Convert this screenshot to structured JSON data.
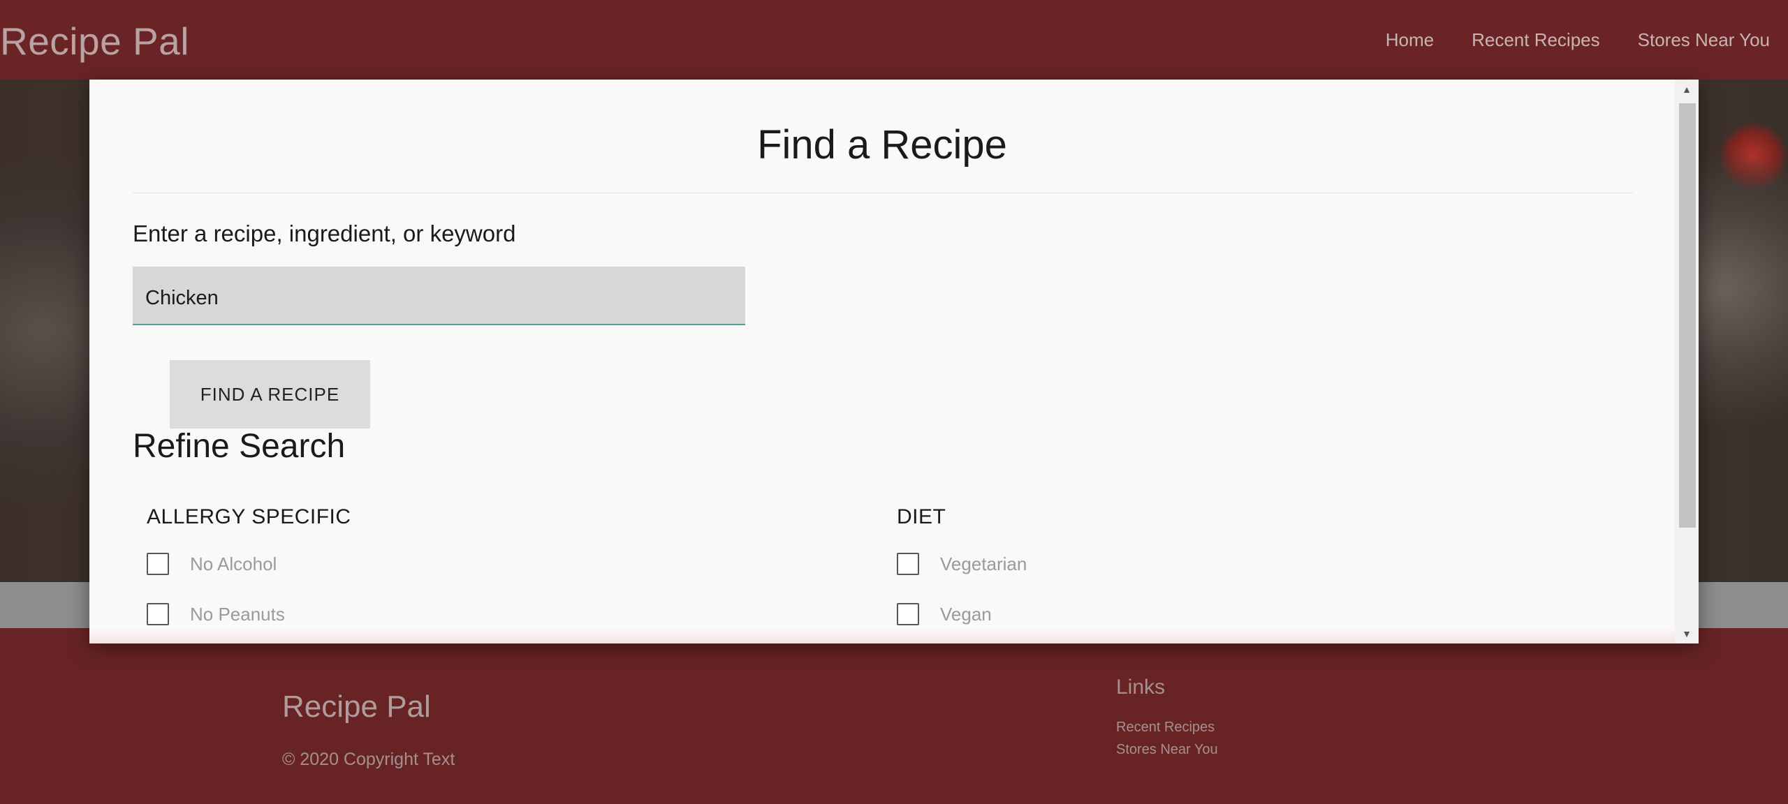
{
  "nav": {
    "brand": "Recipe Pal",
    "links": [
      "Home",
      "Recent Recipes",
      "Stores Near You"
    ]
  },
  "modal": {
    "title": "Find a Recipe",
    "search_label": "Enter a recipe, ingredient, or keyword",
    "search_value": "Chicken",
    "find_button": "FIND A RECIPE",
    "refine_title": "Refine Search",
    "allergy": {
      "heading": "ALLERGY SPECIFIC",
      "options": [
        "No Alcohol",
        "No Peanuts"
      ]
    },
    "diet": {
      "heading": "DIET",
      "options": [
        "Vegetarian",
        "Vegan"
      ]
    }
  },
  "footer": {
    "brand": "Recipe Pal",
    "copyright": "© 2020 Copyright Text",
    "links_title": "Links",
    "links": [
      "Recent Recipes",
      "Stores Near You"
    ]
  },
  "colors": {
    "nav_background": "#6a2425",
    "modal_background": "#f9f9f9",
    "input_background": "#d7d7d7",
    "input_underline": "#5a9e9a",
    "button_background": "#dcdcdc"
  },
  "icons": {
    "scroll_up": "scroll-up-arrow-icon",
    "scroll_down": "scroll-down-arrow-icon"
  }
}
